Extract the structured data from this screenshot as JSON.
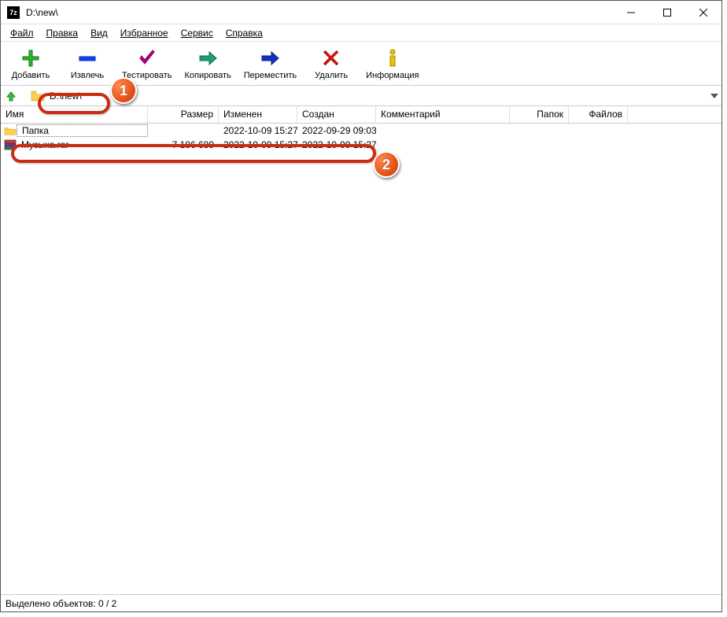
{
  "title": "D:\\new\\",
  "menu": {
    "file": "Файл",
    "edit": "Правка",
    "view": "Вид",
    "favorites": "Избранное",
    "tools": "Сервис",
    "help": "Справка"
  },
  "toolbar": {
    "add": "Добавить",
    "extract": "Извлечь",
    "test": "Тестировать",
    "copy": "Копировать",
    "move": "Переместить",
    "delete": "Удалить",
    "info": "Информация"
  },
  "address": {
    "path": "D:\\new\\"
  },
  "columns": {
    "name": "Имя",
    "size": "Размер",
    "modified": "Изменен",
    "created": "Создан",
    "comment": "Комментарий",
    "folders": "Папок",
    "files": "Файлов"
  },
  "rows": [
    {
      "type": "folder",
      "name": "Папка",
      "size": "",
      "modified": "2022-10-09 15:27",
      "created": "2022-09-29 09:03"
    },
    {
      "type": "rar",
      "name": "Музыка.rar",
      "size": "7 186 689",
      "modified": "2022-10-09 15:27",
      "created": "2022-10-09 15:27"
    }
  ],
  "status": "Выделено объектов: 0 / 2",
  "callouts": {
    "one": "1",
    "two": "2"
  }
}
